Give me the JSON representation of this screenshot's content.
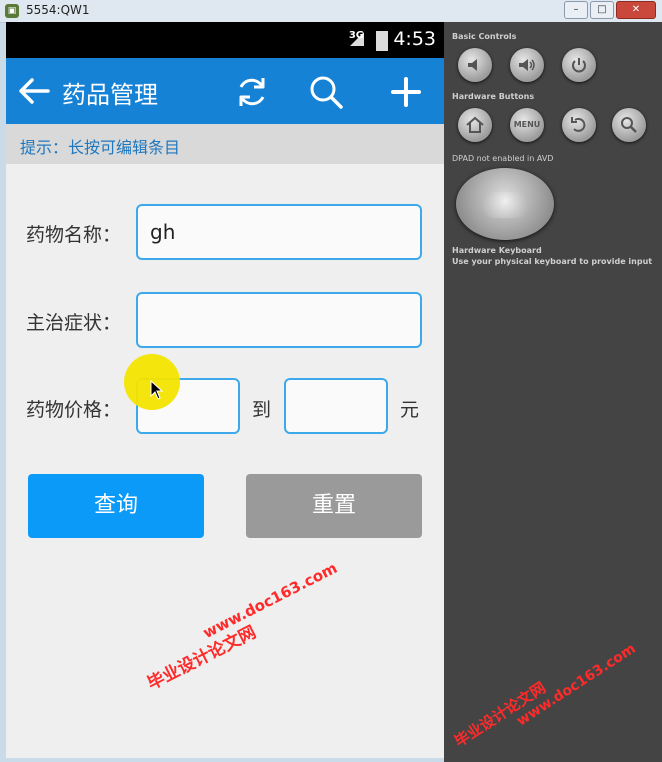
{
  "window": {
    "title": "5554:QW1",
    "icon": "android-emulator-icon"
  },
  "statusbar": {
    "network": "3G",
    "time": "4:53"
  },
  "actionbar": {
    "title": "药品管理",
    "back_icon": "back-arrow-icon",
    "refresh_icon": "refresh-icon",
    "search_icon": "search-icon",
    "add_icon": "plus-icon",
    "color": "#1582d6"
  },
  "hint": "提示：长按可编辑条目",
  "form": {
    "name_label": "药物名称：",
    "name_value": "gh",
    "symptom_label": "主治症状：",
    "symptom_value": "",
    "price_label": "药物价格：",
    "price_from": "",
    "price_to_label": "到",
    "price_to": "",
    "currency_label": "元"
  },
  "buttons": {
    "query": "查询",
    "reset": "重置"
  },
  "watermarks": {
    "url": "www.doc163.com",
    "text": "毕业设计论文网"
  },
  "controls_panel": {
    "basic_controls": "Basic Controls",
    "hardware_buttons": "Hardware Buttons",
    "menu_label": "MENU",
    "dpad_note": "DPAD not enabled in AVD",
    "keyboard_title": "Hardware Keyboard",
    "keyboard_note": "Use your physical keyboard to provide input"
  },
  "colors": {
    "accent": "#0c9af8",
    "field_border": "#3ea9ea",
    "hint_text": "#1f77bd",
    "reset_button": "#9a9a9a"
  }
}
